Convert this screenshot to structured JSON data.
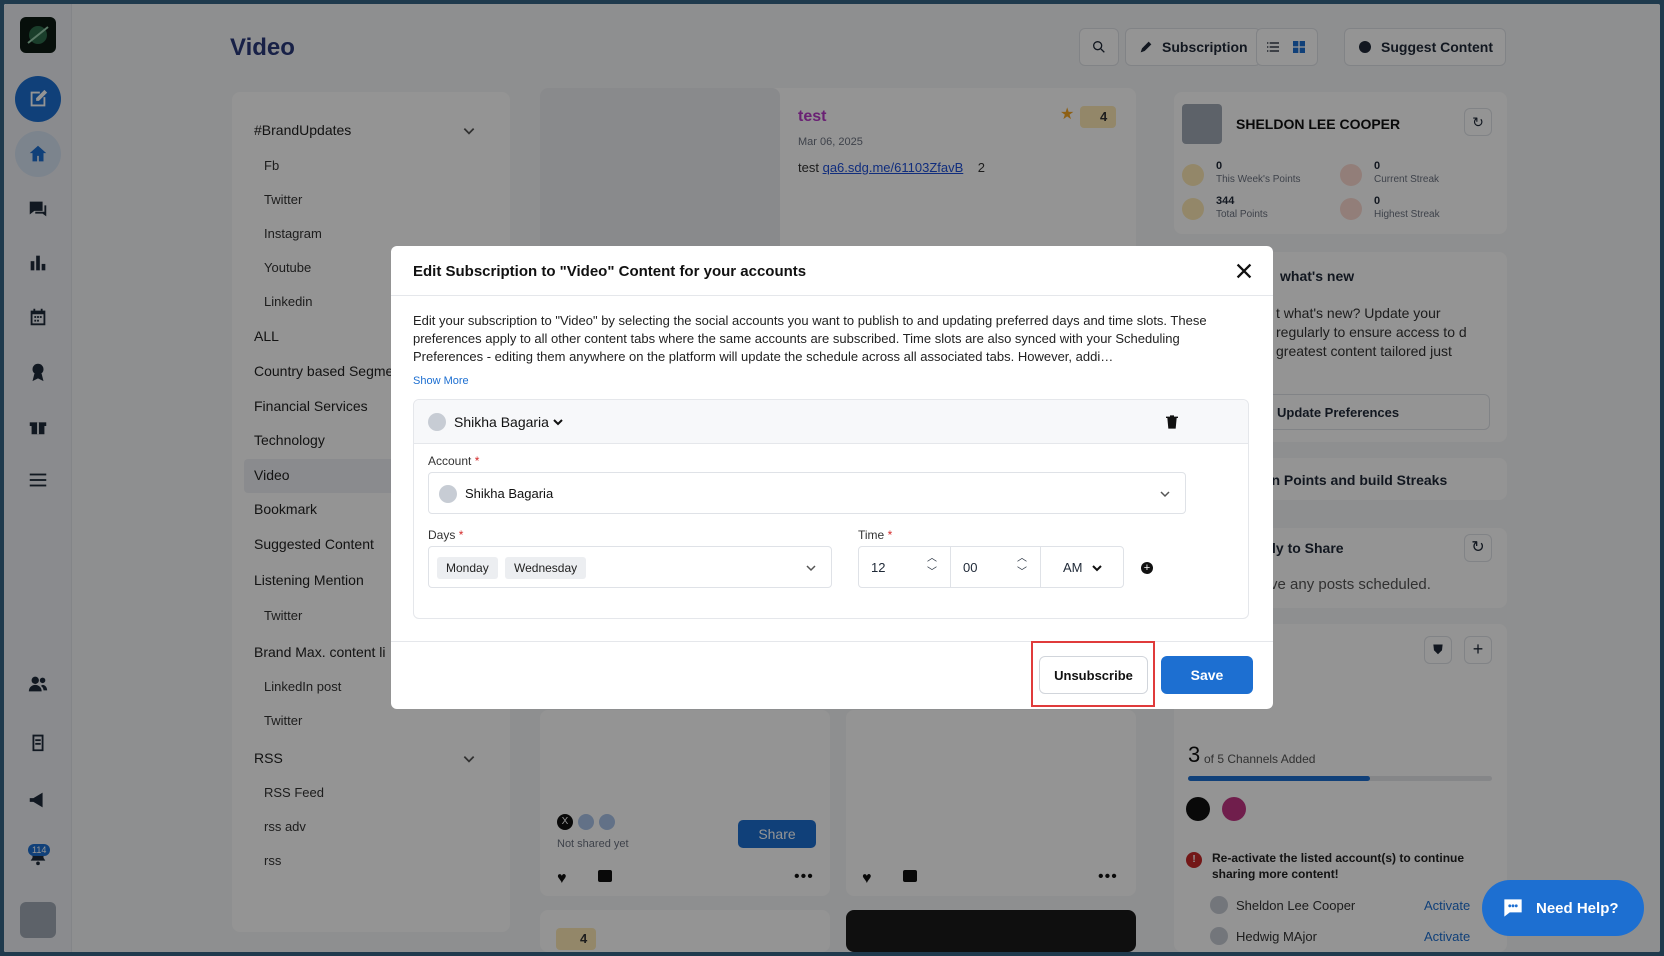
{
  "page": {
    "title": "Video"
  },
  "header": {
    "subscription_label": "Subscription",
    "suggest_label": "Suggest Content"
  },
  "sidebar": {
    "notification_count": "114"
  },
  "categories": [
    {
      "label": "#BrandUpdates",
      "type": "group"
    },
    {
      "label": "Fb",
      "type": "sub"
    },
    {
      "label": "Twitter",
      "type": "sub"
    },
    {
      "label": "Instagram",
      "type": "sub"
    },
    {
      "label": "Youtube",
      "type": "sub"
    },
    {
      "label": "Linkedin",
      "type": "sub"
    },
    {
      "label": "ALL",
      "type": "top"
    },
    {
      "label": "Country based Segme",
      "type": "top"
    },
    {
      "label": "Financial Services",
      "type": "top"
    },
    {
      "label": "Technology",
      "type": "top"
    },
    {
      "label": "Video",
      "type": "top"
    },
    {
      "label": "Bookmark",
      "type": "top"
    },
    {
      "label": "Suggested Content",
      "type": "top"
    },
    {
      "label": "Listening Mention",
      "type": "top"
    },
    {
      "label": "Twitter",
      "type": "sub"
    },
    {
      "label": "Brand Max. content li",
      "type": "top"
    },
    {
      "label": "LinkedIn post",
      "type": "sub"
    },
    {
      "label": "Twitter",
      "type": "sub"
    },
    {
      "label": "RSS",
      "type": "group"
    },
    {
      "label": "RSS Feed",
      "type": "sub"
    },
    {
      "label": "rss adv",
      "type": "sub"
    },
    {
      "label": "rss",
      "type": "sub"
    }
  ],
  "post": {
    "title": "test",
    "date": "Mar 06, 2025",
    "body_prefix": "test",
    "link": "qa6.sdg.me/61103ZfavB",
    "count": "2",
    "points": "4",
    "not_shared": "Not shared yet",
    "share_label": "Share",
    "bottom_points": "4"
  },
  "profile": {
    "name": "SHELDON LEE COOPER",
    "week_points": "0",
    "week_points_label": "This Week's Points",
    "current_streak": "0",
    "current_streak_label": "Current Streak",
    "total_points": "344",
    "total_points_label": "Total Points",
    "highest_streak": "0",
    "highest_streak_label": "Highest Streak"
  },
  "whats_new": {
    "title_partial": "what's new",
    "text_partial": "t what's new? Update your regularly to ensure access to d greatest content tailored just",
    "update_label": "Update Preferences"
  },
  "earn": {
    "title_partial": "rn Points and build Streaks"
  },
  "ready": {
    "title_partial": "ly to Share",
    "text_partial": "ve any posts scheduled."
  },
  "channels": {
    "count": "3",
    "text": "of 5 Channels Added",
    "progress": 0.6,
    "reactivate": "Re-activate the listed account(s) to continue sharing more content!",
    "accounts": [
      {
        "name": "Sheldon Lee Cooper",
        "action": "Activate"
      },
      {
        "name": "Hedwig MAjor",
        "action": "Activate"
      }
    ]
  },
  "modal": {
    "title": "Edit Subscription to \"Video\" Content for your accounts",
    "description": "Edit your subscription to \"Video\" by selecting the social accounts you want to publish to and updating preferred days and time slots. These preferences apply to all other content tabs where the same accounts are subscribed. Time slots are also synced with your Scheduling Preferences - editing them anywhere on the platform will update the schedule across all associated tabs. However, addi…",
    "show_more": "Show More",
    "account_header": "Shikha Bagaria",
    "account_label": "Account",
    "account_value": "Shikha Bagaria",
    "days_label": "Days",
    "days": [
      "Monday",
      "Wednesday"
    ],
    "time_label": "Time",
    "hour": "12",
    "minute": "00",
    "ampm": "AM",
    "unsubscribe_label": "Unsubscribe",
    "save_label": "Save"
  },
  "help": {
    "label": "Need Help?"
  },
  "colors": {
    "primary": "#1d6fd1",
    "title": "#2a3a7a",
    "post_title": "#b73ac8",
    "highlight": "#e03b3b"
  }
}
